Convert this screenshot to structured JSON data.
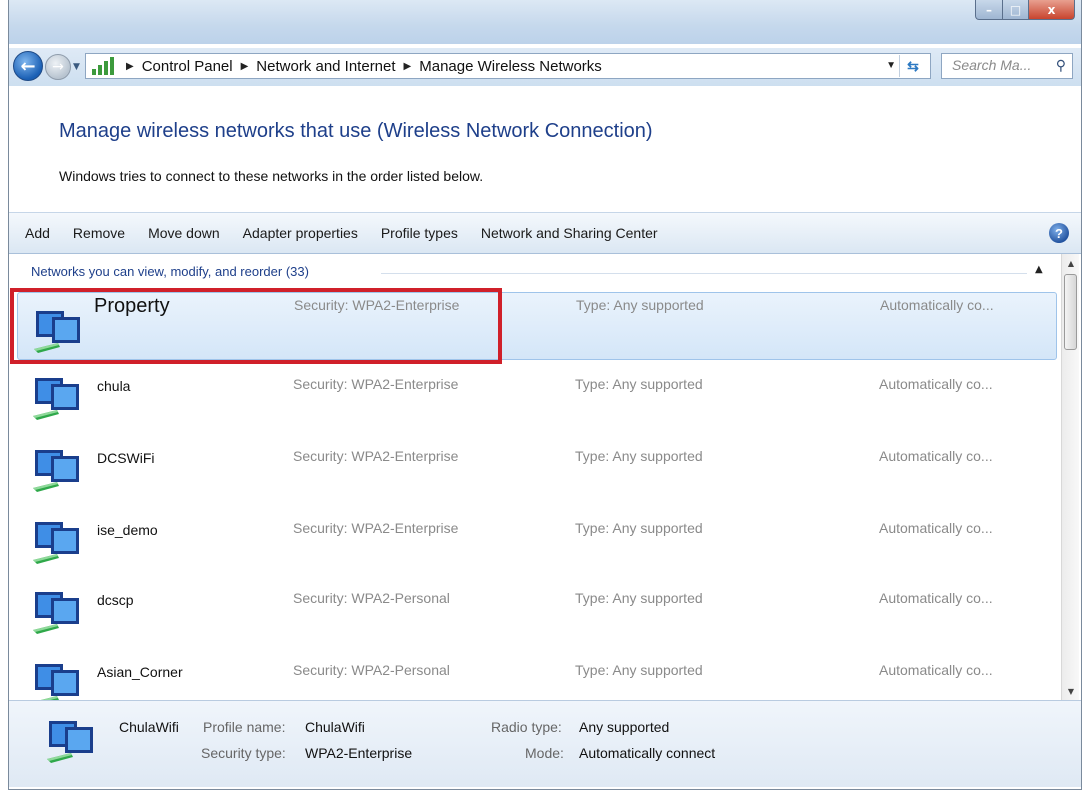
{
  "window": {
    "caption_buttons": {
      "minimize": "–",
      "maximize": "□",
      "close": "x"
    }
  },
  "nav": {
    "breadcrumbs": [
      "Control Panel",
      "Network and Internet",
      "Manage Wireless Networks"
    ],
    "search_placeholder": "Search Ma..."
  },
  "header": {
    "title": "Manage wireless networks that use (Wireless Network Connection)",
    "subtitle": "Windows tries to connect to these networks in the order listed below."
  },
  "toolbar": {
    "items": [
      "Add",
      "Remove",
      "Move down",
      "Adapter properties",
      "Profile types",
      "Network and Sharing Center"
    ]
  },
  "list": {
    "group_header": "Networks you can view, modify, and reorder (33)",
    "rows": [
      {
        "name": "Property",
        "security": "Security:  WPA2-Enterprise",
        "type": "Type:  Any supported",
        "mode": "Automatically co...",
        "selected": true
      },
      {
        "name": "chula",
        "security": "Security:  WPA2-Enterprise",
        "type": "Type:  Any supported",
        "mode": "Automatically co..."
      },
      {
        "name": "DCSWiFi",
        "security": "Security:  WPA2-Enterprise",
        "type": "Type:  Any supported",
        "mode": "Automatically co..."
      },
      {
        "name": "ise_demo",
        "security": "Security:  WPA2-Enterprise",
        "type": "Type:  Any supported",
        "mode": "Automatically co..."
      },
      {
        "name": "dcscp",
        "security": "Security:  WPA2-Personal",
        "type": "Type:  Any supported",
        "mode": "Automatically co..."
      },
      {
        "name": "Asian_Corner",
        "security": "Security:  WPA2-Personal",
        "type": "Type:  Any supported",
        "mode": "Automatically co..."
      }
    ]
  },
  "details": {
    "name": "ChulaWifi",
    "profile_name_label": "Profile name:",
    "profile_name": "ChulaWifi",
    "security_type_label": "Security type:",
    "security_type": "WPA2-Enterprise",
    "radio_type_label": "Radio type:",
    "radio_type": "Any supported",
    "mode_label": "Mode:",
    "mode": "Automatically connect"
  },
  "colors": {
    "title_blue": "#1e3f8a",
    "highlight_red": "#d0202a",
    "selection_bg": "#d4e6f8"
  }
}
